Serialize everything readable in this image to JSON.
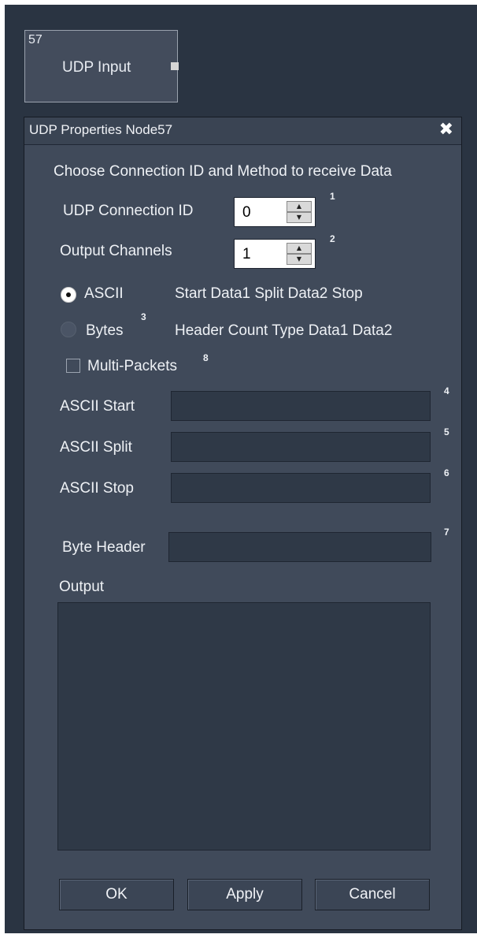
{
  "node": {
    "id": "57",
    "title": "UDP Input"
  },
  "dialog": {
    "title": "UDP Properties Node57",
    "close_glyph": "✖",
    "instruction": "Choose Connection ID and Method to receive Data",
    "connection_id": {
      "label": "UDP Connection ID",
      "value": "0",
      "note": "1"
    },
    "output_channels": {
      "label": "Output Channels",
      "value": "1",
      "note": "2"
    },
    "method": {
      "ascii": {
        "label": "ASCII",
        "selected": true,
        "format": "Start Data1 Split Data2 Stop"
      },
      "bytes": {
        "label": "Bytes",
        "selected": false,
        "note": "3",
        "format": "Header Count Type Data1 Data2"
      }
    },
    "multi_packets": {
      "label": "Multi-Packets",
      "checked": false,
      "note": "8"
    },
    "ascii_start": {
      "label": "ASCII Start",
      "value": "",
      "note": "4"
    },
    "ascii_split": {
      "label": "ASCII Split",
      "value": "",
      "note": "5"
    },
    "ascii_stop": {
      "label": "ASCII Stop",
      "value": "",
      "note": "6"
    },
    "byte_header": {
      "label": "Byte Header",
      "value": "",
      "note": "7"
    },
    "output": {
      "label": "Output"
    },
    "buttons": {
      "ok": "OK",
      "apply": "Apply",
      "cancel": "Cancel"
    }
  },
  "colors": {
    "canvas": "#2a3442",
    "dialog_bg": "#404a5a",
    "field_bg": "#2f3947",
    "text": "#eef1f5"
  }
}
